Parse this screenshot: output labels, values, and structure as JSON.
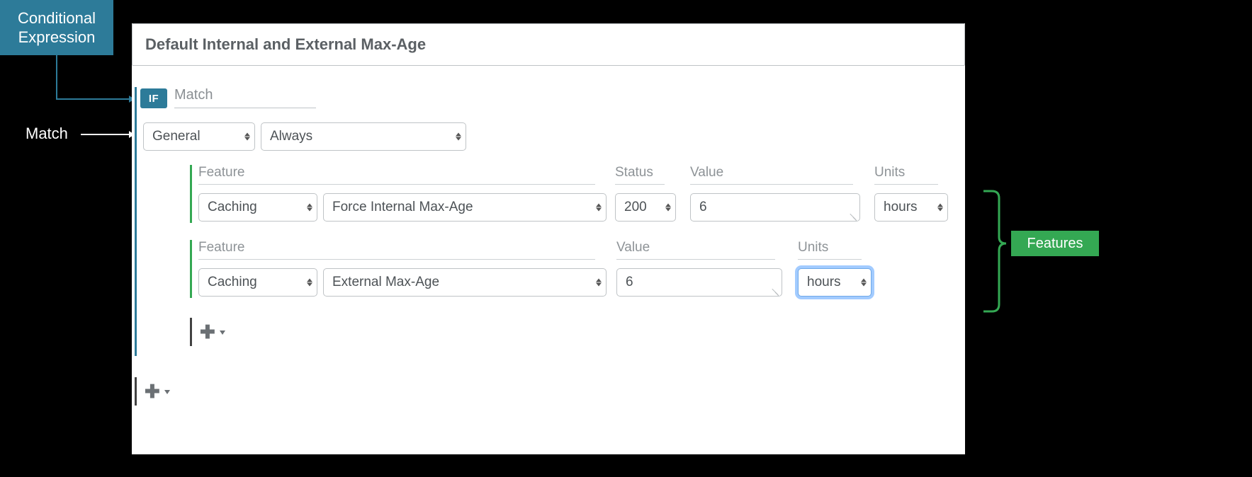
{
  "callouts": {
    "conditional_line1": "Conditional",
    "conditional_line2": "Expression",
    "match": "Match",
    "features": "Features"
  },
  "rule": {
    "title": "Default Internal and External Max-Age",
    "if_badge": "IF",
    "if_label": "Match",
    "match": {
      "category": "General",
      "condition": "Always"
    },
    "features": [
      {
        "labels": {
          "feature": "Feature",
          "status": "Status",
          "value": "Value",
          "units": "Units"
        },
        "category": "Caching",
        "name": "Force Internal Max-Age",
        "status": "200",
        "value": "6",
        "units": "hours"
      },
      {
        "labels": {
          "feature": "Feature",
          "value": "Value",
          "units": "Units"
        },
        "category": "Caching",
        "name": "External Max-Age",
        "value": "6",
        "units": "hours"
      }
    ]
  }
}
